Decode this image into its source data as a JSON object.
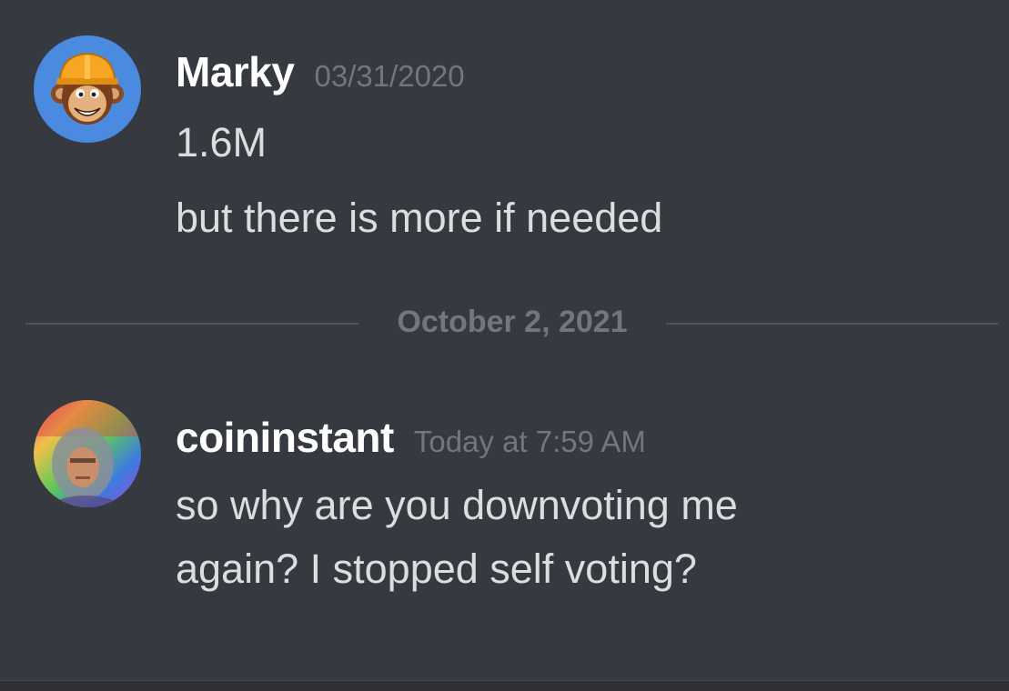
{
  "messages": [
    {
      "author": "Marky",
      "timestamp": "03/31/2020",
      "avatar_icon": "monkey-hardhat-avatar",
      "avatar_bg": "#4a8be0",
      "lines": [
        "1.6M",
        "but there is more if needed"
      ]
    },
    {
      "author": "coininstant",
      "timestamp": "Today at 7:59 AM",
      "avatar_icon": "person-rainbow-avatar",
      "lines": [
        "so why are you downvoting me",
        "again? I stopped self voting?"
      ]
    }
  ],
  "divider": {
    "date": "October 2, 2021"
  },
  "colors": {
    "background": "#36393f",
    "username": "#ffffff",
    "timestamp": "#72767d",
    "message_text": "#dcddde",
    "divider_line": "#4f545c"
  }
}
